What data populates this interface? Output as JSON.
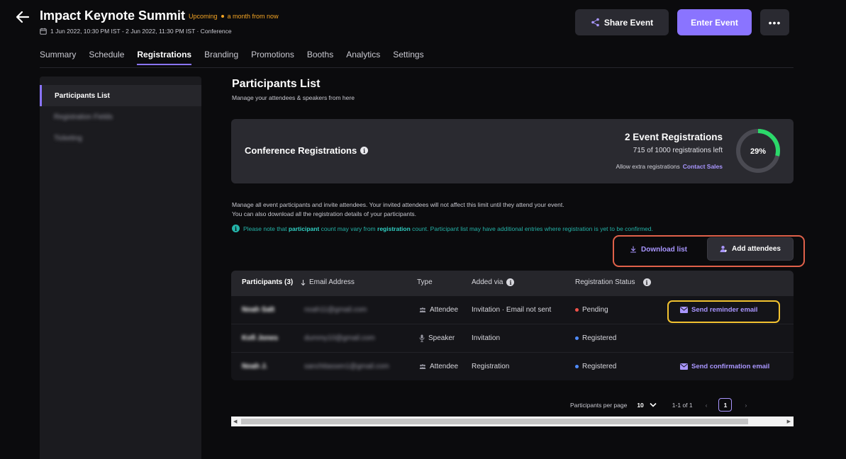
{
  "header": {
    "title": "Impact Keynote Summit",
    "status": "Upcoming",
    "relative_time": "a month from now",
    "date_range": "1 Jun 2022, 10:30 PM IST - 2 Jun 2022, 11:30 PM IST · Conference",
    "share_label": "Share Event",
    "enter_label": "Enter Event",
    "more_label": "•••"
  },
  "tabs": [
    {
      "label": "Summary",
      "active": false
    },
    {
      "label": "Schedule",
      "active": false
    },
    {
      "label": "Registrations",
      "active": true
    },
    {
      "label": "Branding",
      "active": false
    },
    {
      "label": "Promotions",
      "active": false
    },
    {
      "label": "Booths",
      "active": false
    },
    {
      "label": "Analytics",
      "active": false
    },
    {
      "label": "Settings",
      "active": false
    }
  ],
  "sidebar": {
    "items": [
      {
        "label": "Participants List",
        "active": true
      },
      {
        "label": "Registration Fields",
        "active": false
      },
      {
        "label": "Ticketing",
        "active": false
      }
    ]
  },
  "main": {
    "title": "Participants List",
    "subtitle": "Manage your attendees & speakers from here",
    "card": {
      "title": "Conference Registrations",
      "count": "2 Event Registrations",
      "left": "715 of 1000 registrations left",
      "extra": "Allow extra registrations",
      "contact": "Contact Sales",
      "percent_label": "29%",
      "percent": 29
    },
    "desc1": "Manage all event participants and invite attendees. Your invited attendees will not affect this limit until they attend your event.",
    "desc2": "You can also download all the registration details of your participants.",
    "note": {
      "pre": "Please note that",
      "b1": "participant",
      "mid": "count may vary from",
      "b2": "registration",
      "post": "count. Participant list may have additional entries where registration is yet to be confirmed."
    },
    "download_label": "Download list",
    "add_label": "Add attendees"
  },
  "table": {
    "headers": {
      "participants": "Participants (3)",
      "email": "Email Address",
      "type": "Type",
      "added_via": "Added via",
      "status": "Registration Status"
    },
    "rows": [
      {
        "name": "Noah Salt",
        "email": "noah11@gmail.com",
        "type": "Attendee",
        "added": "Invitation  ·  Email not sent",
        "status": "Pending",
        "status_color": "#f0524a",
        "action": "Send reminder email"
      },
      {
        "name": "Kofi Jones",
        "email": "dummy10@gmail.com",
        "type": "Speaker",
        "added": "Invitation",
        "status": "Registered",
        "status_color": "#4f8cff",
        "action": ""
      },
      {
        "name": "Noah J.",
        "email": "sanchitassen1@gmail.com",
        "type": "Attendee",
        "added": "Registration",
        "status": "Registered",
        "status_color": "#4f8cff",
        "action": "Send confirmation email"
      }
    ]
  },
  "pagination": {
    "per_page_label": "Participants per page",
    "per_page": "10",
    "range": "1-1 of 1",
    "page": "1"
  },
  "colors": {
    "accent": "#8a74ff",
    "warning": "#f5a524",
    "teal": "#24b3a8",
    "pending": "#f0524a",
    "registered": "#4f8cff",
    "highlight_red": "#e0614a",
    "highlight_yellow": "#f2c230"
  }
}
